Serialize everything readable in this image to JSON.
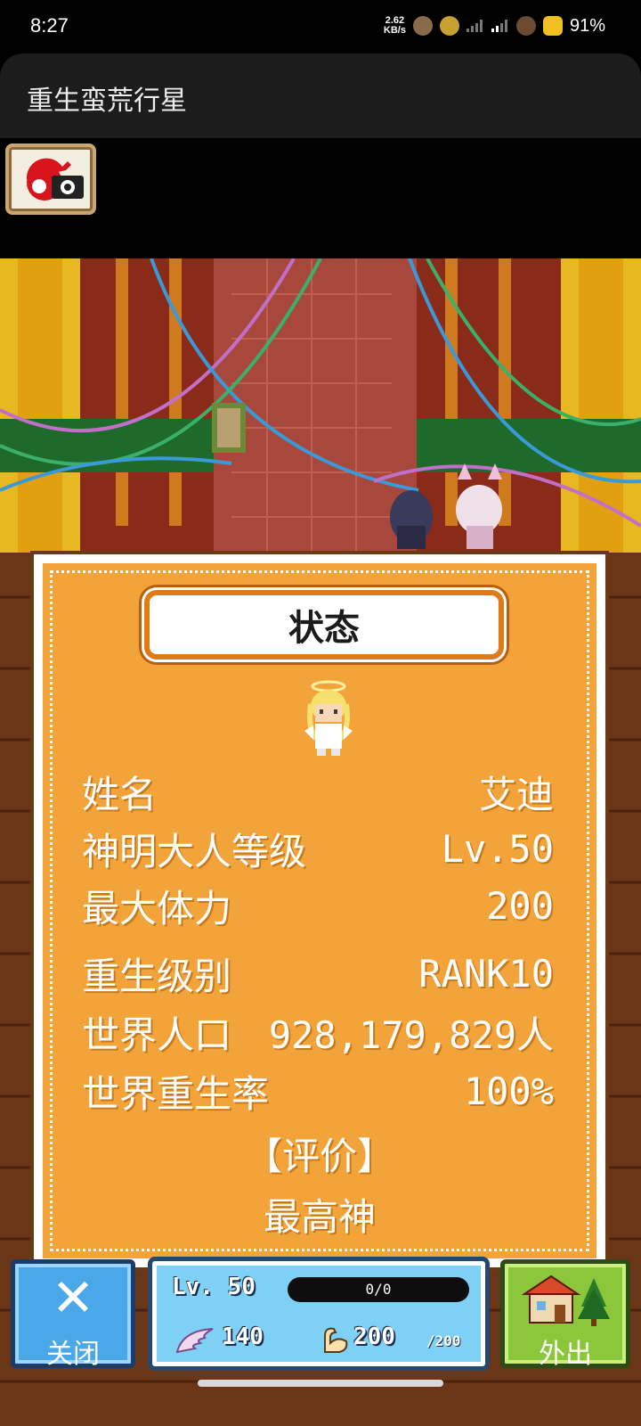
{
  "status_bar": {
    "time": "8:27",
    "net_speed_value": "2.62",
    "net_speed_unit": "KB/s",
    "battery": "91%"
  },
  "app": {
    "title": "重生蛮荒行星"
  },
  "toolbar": {
    "screenshot_icon": "camera-icon"
  },
  "panel": {
    "title": "状态",
    "rows": [
      {
        "label": "姓名",
        "value": "艾迪"
      },
      {
        "label": "神明大人等级",
        "value": "Lv.50"
      },
      {
        "label": "最大体力",
        "value": "200"
      },
      {
        "label": "重生级别",
        "value": "RANK10"
      },
      {
        "label": "世界人口",
        "value": "928,179,829人"
      },
      {
        "label": "世界重生率",
        "value": "100%"
      }
    ],
    "rating_heading": "【评价】",
    "rating_value": "最高神"
  },
  "hud": {
    "close_label": "关闭",
    "level": "Lv. 50",
    "xp_text": "0/0",
    "power": "140",
    "stamina": "200",
    "stamina_max": "/200",
    "outing_label": "外出"
  },
  "colors": {
    "panel": "#f2a43a",
    "close_button": "#4aa8e8",
    "outing_button": "#8cc63a",
    "hud_stats": "#7ed0f4"
  }
}
